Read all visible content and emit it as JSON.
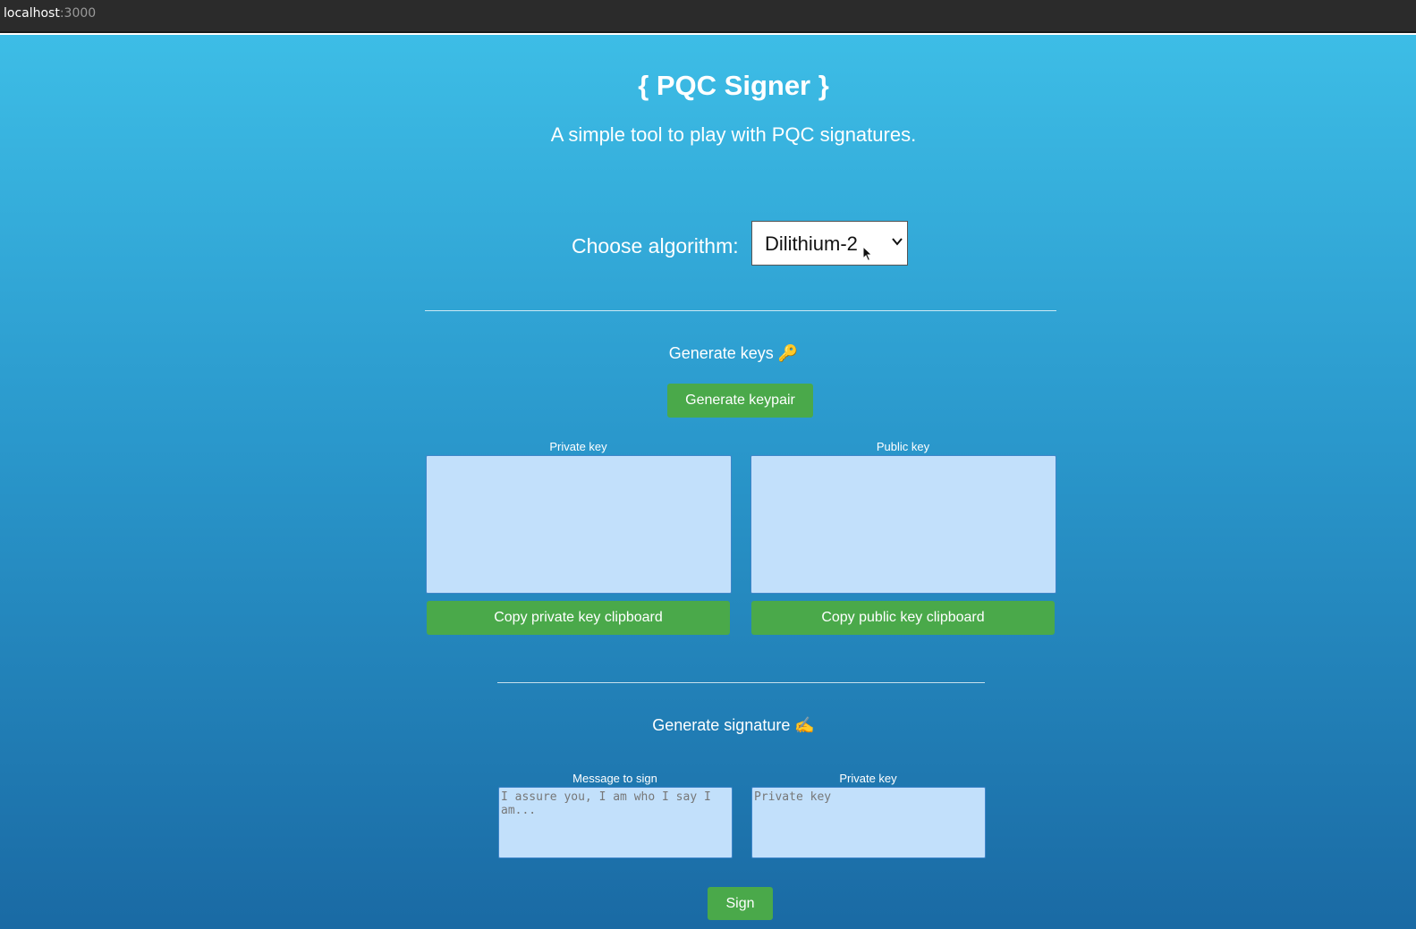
{
  "browser": {
    "url_host": "localhost",
    "url_port": ":3000"
  },
  "header": {
    "title": "{ PQC Signer }",
    "subtitle": "A simple tool to play with PQC signatures."
  },
  "algorithm": {
    "label": "Choose algorithm:",
    "selected": "Dilithium-2"
  },
  "keys": {
    "section_title": "Generate keys 🔑",
    "generate_button": "Generate keypair",
    "private_label": "Private key",
    "public_label": "Public key",
    "private_value": "",
    "public_value": "",
    "copy_private_button": "Copy private key clipboard",
    "copy_public_button": "Copy public key clipboard"
  },
  "signature": {
    "section_title": "Generate signature ✍️",
    "message_label": "Message to sign",
    "message_placeholder": "I assure you, I am who I say I am...",
    "private_label": "Private key",
    "private_placeholder": "Private key",
    "sign_button": "Sign"
  },
  "colors": {
    "accent_button": "#4aa94a",
    "textarea_bg": "#c2e0fb"
  }
}
